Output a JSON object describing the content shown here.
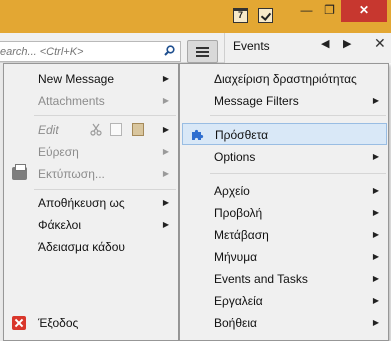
{
  "titlebar": {
    "calendar_icon_text": "7",
    "minimize_label": "—",
    "maximize_label": "❐",
    "close_label": "✕"
  },
  "search": {
    "placeholder": "earch... <Ctrl+K>"
  },
  "events_pane": {
    "title": "Events",
    "prev_label": "◀",
    "next_label": "▶",
    "close_label": "✕"
  },
  "left_menu": {
    "new_message": "New Message",
    "attachments": "Attachments",
    "edit": "Edit",
    "find": "Εύρεση",
    "print": "Εκτύπωση...",
    "save_as": "Αποθήκευση ως",
    "folders": "Φάκελοι",
    "empty_trash": "Άδειασμα κάδου",
    "exit": "Έξοδος",
    "arrow": "▶"
  },
  "right_menu": {
    "manage_activities": "Διαχείριση δραστηριότητας",
    "message_filters": "Message Filters",
    "addons": "Πρόσθετα",
    "options": "Options",
    "file": "Αρχείο",
    "view": "Προβολή",
    "go": "Μετάβαση",
    "message": "Μήνυμα",
    "events_tasks": "Events and Tasks",
    "tools": "Εργαλεία",
    "help": "Βοήθεια",
    "arrow": "▶"
  },
  "colors": {
    "titlebar": "#e3a733",
    "close_button": "#c7372f",
    "highlight_bg": "#d9e8f7",
    "highlight_border": "#99bde3",
    "puzzle_icon": "#2f6fd0"
  }
}
